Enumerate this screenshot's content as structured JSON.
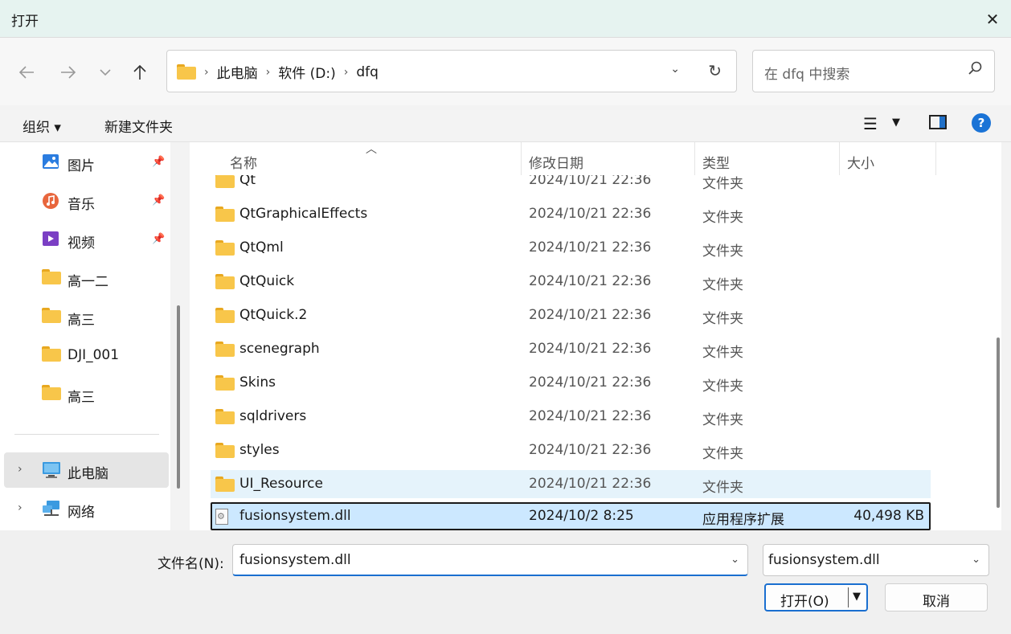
{
  "window": {
    "title": "打开",
    "close_icon": "close-icon"
  },
  "navigation": {
    "back_icon": "arrow-left-icon",
    "forward_icon": "arrow-right-icon",
    "recent_icon": "chevron-down-icon",
    "up_icon": "arrow-up-icon",
    "breadcrumbs": [
      "此电脑",
      "软件 (D:)",
      "dfq"
    ],
    "search_placeholder": "在 dfq 中搜索"
  },
  "commands": {
    "organize": "组织 ▾",
    "new_folder": "新建文件夹"
  },
  "sidebar": {
    "quick_access": [
      {
        "label": "图片",
        "icon": "pictures-icon",
        "pinned": true
      },
      {
        "label": "音乐",
        "icon": "music-icon",
        "pinned": true
      },
      {
        "label": "视频",
        "icon": "videos-icon",
        "pinned": true
      },
      {
        "label": "高一二",
        "icon": "folder-icon",
        "pinned": false
      },
      {
        "label": "高三",
        "icon": "folder-icon",
        "pinned": false
      },
      {
        "label": "DJI_001",
        "icon": "folder-icon",
        "pinned": false
      },
      {
        "label": "高三",
        "icon": "folder-icon",
        "pinned": false
      }
    ],
    "locations": [
      {
        "label": "此电脑",
        "icon": "computer-icon",
        "selected": true
      },
      {
        "label": "网络",
        "icon": "network-icon",
        "selected": false
      }
    ]
  },
  "columns": {
    "name": "名称",
    "date": "修改日期",
    "type": "类型",
    "size": "大小"
  },
  "files": [
    {
      "name": "Qt",
      "date": "2024/10/21 22:36",
      "type": "文件夹",
      "size": "",
      "kind": "folder"
    },
    {
      "name": "QtGraphicalEffects",
      "date": "2024/10/21 22:36",
      "type": "文件夹",
      "size": "",
      "kind": "folder"
    },
    {
      "name": "QtQml",
      "date": "2024/10/21 22:36",
      "type": "文件夹",
      "size": "",
      "kind": "folder"
    },
    {
      "name": "QtQuick",
      "date": "2024/10/21 22:36",
      "type": "文件夹",
      "size": "",
      "kind": "folder"
    },
    {
      "name": "QtQuick.2",
      "date": "2024/10/21 22:36",
      "type": "文件夹",
      "size": "",
      "kind": "folder"
    },
    {
      "name": "scenegraph",
      "date": "2024/10/21 22:36",
      "type": "文件夹",
      "size": "",
      "kind": "folder"
    },
    {
      "name": "Skins",
      "date": "2024/10/21 22:36",
      "type": "文件夹",
      "size": "",
      "kind": "folder"
    },
    {
      "name": "sqldrivers",
      "date": "2024/10/21 22:36",
      "type": "文件夹",
      "size": "",
      "kind": "folder"
    },
    {
      "name": "styles",
      "date": "2024/10/21 22:36",
      "type": "文件夹",
      "size": "",
      "kind": "folder"
    },
    {
      "name": "UI_Resource",
      "date": "2024/10/21 22:36",
      "type": "文件夹",
      "size": "",
      "kind": "folder",
      "state": "hover"
    },
    {
      "name": "fusionsystem.dll",
      "date": "2024/10/2 8:25",
      "type": "应用程序扩展",
      "size": "40,498 KB",
      "kind": "file",
      "state": "selected"
    }
  ],
  "footer": {
    "filename_label": "文件名(N):",
    "filename_value": "fusionsystem.dll",
    "filetype_value": "fusionsystem.dll",
    "open_label": "打开(O)",
    "cancel_label": "取消"
  },
  "colors": {
    "accent": "#1a6fd0",
    "folder": "#f8c64a",
    "selection": "#cce8ff",
    "hover": "#e5f3fb"
  }
}
